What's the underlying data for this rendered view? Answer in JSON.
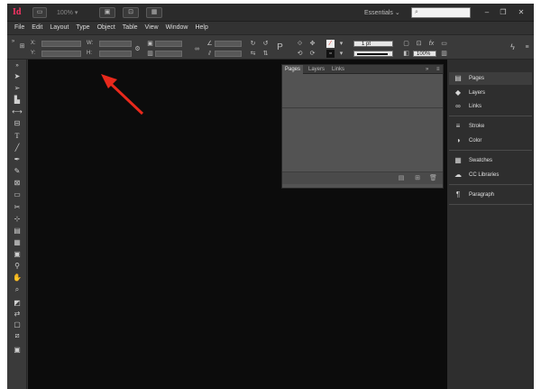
{
  "titlebar": {
    "logo": "Id",
    "zoom": "100%",
    "workspace": "Essentials",
    "workspace_chevron": "⌄",
    "search_icon": "⌕",
    "window_minimize": "–",
    "window_restore": "❐",
    "window_close": "✕"
  },
  "menu": [
    "File",
    "Edit",
    "Layout",
    "Type",
    "Object",
    "Table",
    "View",
    "Window",
    "Help"
  ],
  "control": {
    "x_label": "X:",
    "y_label": "Y:",
    "w_label": "W:",
    "h_label": "H:",
    "stroke_weight": "1 pt",
    "zoom_value": "100%"
  },
  "float_panel": {
    "tabs": [
      "Pages",
      "Layers",
      "Links"
    ]
  },
  "dock": {
    "items": [
      {
        "label": "Pages",
        "icon": "pages-icon",
        "glyph": "▤"
      },
      {
        "label": "Layers",
        "icon": "layers-icon",
        "glyph": "◆"
      },
      {
        "label": "Links",
        "icon": "links-icon",
        "glyph": "∞"
      },
      {
        "label": "Stroke",
        "icon": "stroke-icon",
        "glyph": "≡"
      },
      {
        "label": "Color",
        "icon": "color-icon",
        "glyph": "◑"
      },
      {
        "label": "Swatches",
        "icon": "swatches-icon",
        "glyph": "▦"
      },
      {
        "label": "CC Libraries",
        "icon": "cc-libraries-icon",
        "glyph": "☁"
      },
      {
        "label": "Paragraph",
        "icon": "paragraph-icon",
        "glyph": "¶"
      }
    ]
  },
  "colors": {
    "accent": "#ff3366",
    "arrow": "#e8291c",
    "pasteboard": "#0c0c0c",
    "panel": "#535353"
  }
}
